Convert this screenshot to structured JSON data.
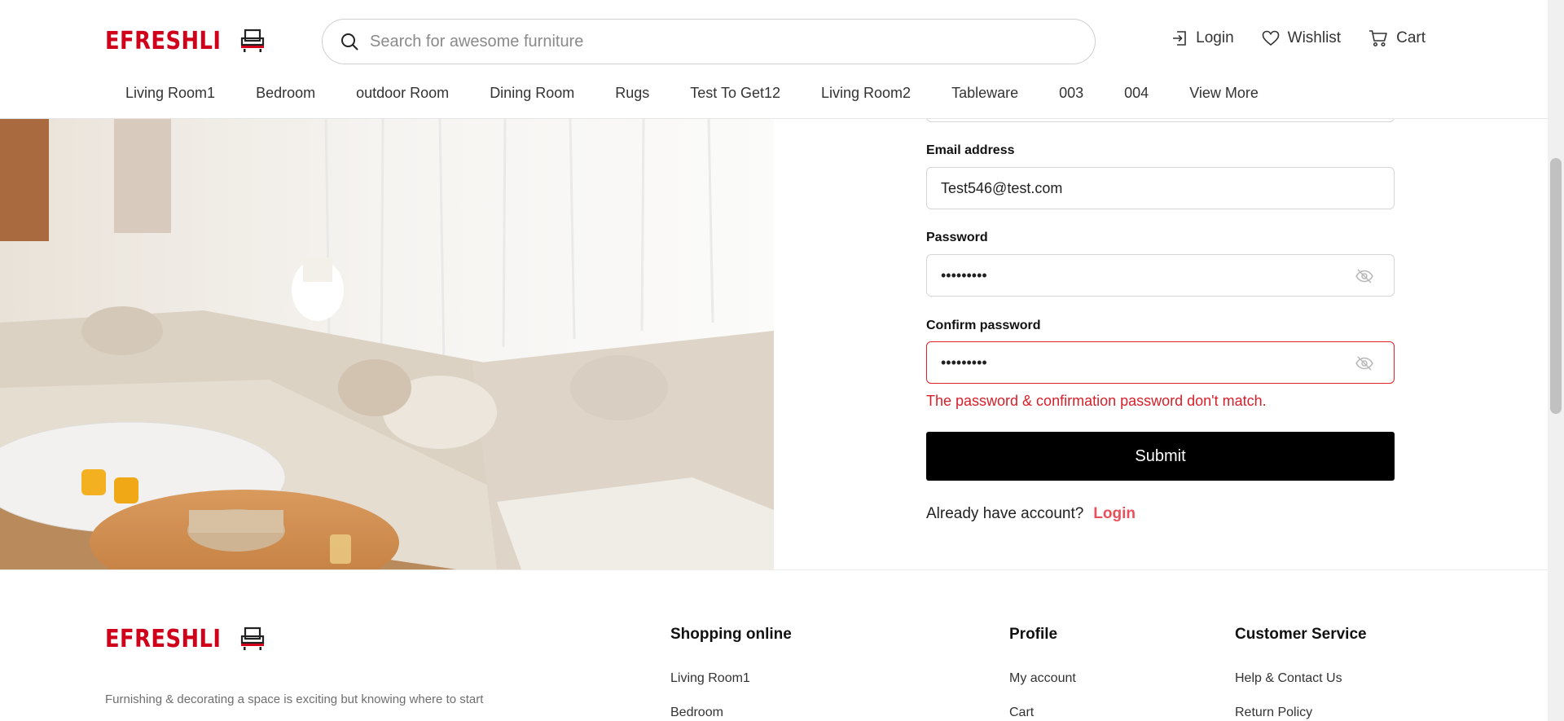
{
  "brand": {
    "name": "EFRESHLI",
    "color": "#d0021b"
  },
  "search": {
    "placeholder": "Search for awesome furniture"
  },
  "header_actions": [
    {
      "label": "Login",
      "icon": "login-icon"
    },
    {
      "label": "Wishlist",
      "icon": "heart-icon"
    },
    {
      "label": "Cart",
      "icon": "cart-icon"
    }
  ],
  "nav": [
    "Living Room1",
    "Bedroom",
    "outdoor Room",
    "Dining Room",
    "Rugs",
    "Test To Get12",
    "Living Room2",
    "Tableware",
    "003",
    "004",
    "View More"
  ],
  "form": {
    "email_label": "Email address",
    "email_value": "Test546@test.com",
    "password_label": "Password",
    "password_value": "•••••••••",
    "confirm_label": "Confirm password",
    "confirm_value": "•••••••••",
    "error": "The password & confirmation password don't match.",
    "submit_label": "Submit",
    "already_text": "Already have account?",
    "login_link": "Login",
    "error_color": "#e0202b",
    "link_color": "#e8505b"
  },
  "footer": {
    "description": "Furnishing & decorating a space is exciting but knowing where to start",
    "columns": [
      {
        "title": "Shopping online",
        "links": [
          "Living Room1",
          "Bedroom"
        ]
      },
      {
        "title": "Profile",
        "links": [
          "My account",
          "Cart"
        ]
      },
      {
        "title": "Customer Service",
        "links": [
          "Help & Contact Us",
          "Return Policy"
        ]
      }
    ]
  }
}
